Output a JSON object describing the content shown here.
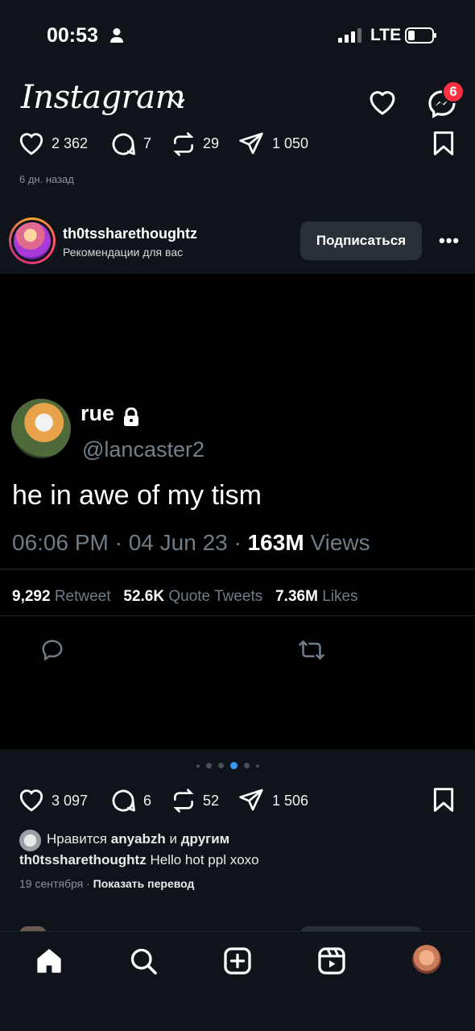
{
  "status_bar": {
    "time": "00:53",
    "network": "LTE"
  },
  "header": {
    "app_title": "Instagram",
    "messages_badge": "6"
  },
  "prev_post": {
    "likes": "2 362",
    "comments": "7",
    "reposts": "29",
    "shares": "1 050",
    "time_ago": "6 дн. назад"
  },
  "post": {
    "username": "th0tssharethoughtz",
    "subtitle": "Рекомендации для вас",
    "follow_label": "Подписаться",
    "tweet": {
      "name": "rue",
      "handle": "@lancaster2",
      "text": "he in awe of my tism",
      "time": "06:06 PM · 04 Jun 23 ·",
      "views_count": "163M",
      "views_label": "Views",
      "retweets_count": "9,292",
      "retweets_label": "Retweet",
      "quotes_count": "52.6K",
      "quotes_label": "Quote Tweets",
      "likes_count": "7.36M",
      "likes_label": "Likes"
    },
    "carousel": {
      "total": 6,
      "active_index": 3
    },
    "likes": "3 097",
    "comments": "6",
    "reposts": "52",
    "shares": "1 506",
    "liked_by_prefix": "Нравится",
    "liked_by_user": "anyabzh",
    "liked_by_conj": "и",
    "liked_by_others": "другим",
    "caption_user": "th0tssharethoughtz",
    "caption_text": "Hello hot ppl xoxo",
    "date": "19 сентября",
    "translate_label": "Показать перевод"
  },
  "nav": {
    "items": [
      "home-icon",
      "search-icon",
      "create-icon",
      "reels-icon",
      "profile-avatar"
    ]
  },
  "colors": {
    "background": "#0f141b",
    "badge": "#ff3040",
    "active_dot": "#3897f0"
  }
}
